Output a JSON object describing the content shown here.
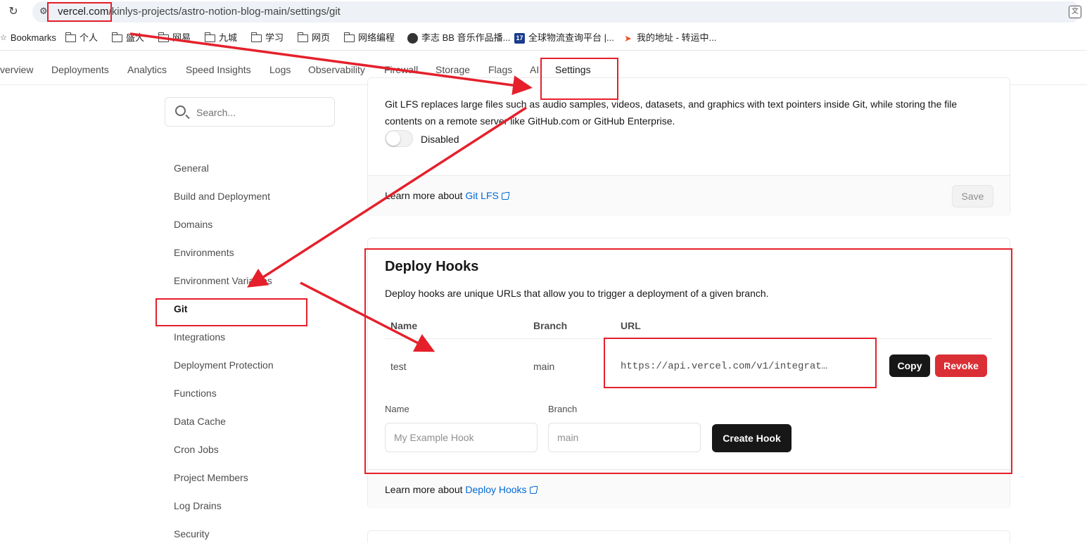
{
  "browser": {
    "url_host": "vercel.com",
    "url_path": "/kinlys-projects/astro-notion-blog-main/settings/git"
  },
  "bookmarks": [
    {
      "label": "Bookmarks",
      "icon": "star-icon"
    },
    {
      "label": "个人",
      "icon": "folder-icon"
    },
    {
      "label": "盛大",
      "icon": "folder-icon"
    },
    {
      "label": "网易",
      "icon": "folder-icon"
    },
    {
      "label": "九城",
      "icon": "folder-icon"
    },
    {
      "label": "学习",
      "icon": "folder-icon"
    },
    {
      "label": "网页",
      "icon": "folder-icon"
    },
    {
      "label": "网络编程",
      "icon": "folder-icon"
    },
    {
      "label": "李志 BB 音乐作品播...",
      "icon": "person-favicon"
    },
    {
      "label": "全球物流查询平台 |...",
      "icon": "17track-favicon"
    },
    {
      "label": "我的地址 - 转运中...",
      "icon": "bird-favicon"
    }
  ],
  "nav": {
    "tabs": [
      "verview",
      "Deployments",
      "Analytics",
      "Speed Insights",
      "Logs",
      "Observability",
      "Firewall",
      "Storage",
      "Flags",
      "AI",
      "Settings"
    ],
    "active": "Settings"
  },
  "sidebar": {
    "search_placeholder": "Search...",
    "items": [
      "General",
      "Build and Deployment",
      "Domains",
      "Environments",
      "Environment Variables",
      "Git",
      "Integrations",
      "Deployment Protection",
      "Functions",
      "Data Cache",
      "Cron Jobs",
      "Project Members",
      "Log Drains",
      "Security"
    ],
    "active": "Git"
  },
  "git_lfs": {
    "description": "Git LFS replaces large files such as audio samples, videos, datasets, and graphics with text pointers inside Git, while storing the file contents on a remote server like GitHub.com or GitHub Enterprise.",
    "toggle_label": "Disabled",
    "learn_more_prefix": "Learn more about ",
    "learn_more_link": "Git LFS",
    "save_label": "Save"
  },
  "deploy_hooks": {
    "title": "Deploy Hooks",
    "description": "Deploy hooks are unique URLs that allow you to trigger a deployment of a given branch.",
    "columns": [
      "Name",
      "Branch",
      "URL"
    ],
    "rows": [
      {
        "name": "test",
        "branch": "main",
        "url": "https://api.vercel.com/v1/integrat…"
      }
    ],
    "copy_label": "Copy",
    "revoke_label": "Revoke",
    "name_label": "Name",
    "name_placeholder": "My Example Hook",
    "branch_label": "Branch",
    "branch_placeholder": "main",
    "create_label": "Create Hook",
    "learn_more_prefix": "Learn more about ",
    "learn_more_link": "Deploy Hooks"
  },
  "colors": {
    "annotation_red": "#e5202b",
    "link_blue": "#0068d6",
    "revoke_red": "#da2f35"
  }
}
